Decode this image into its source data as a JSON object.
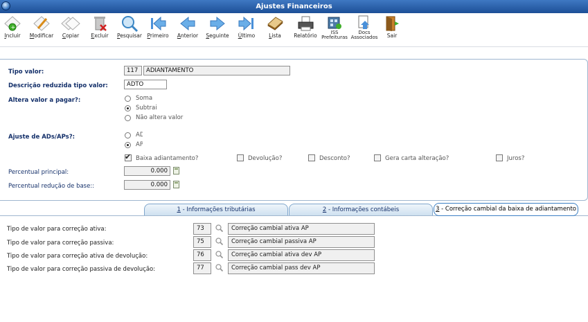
{
  "window": {
    "title": "Ajustes Financeiros"
  },
  "toolbar": {
    "items": [
      {
        "key": "I",
        "rest": "ncluir",
        "icon": "add-icon"
      },
      {
        "key": "M",
        "rest": "odificar",
        "icon": "edit-icon"
      },
      {
        "key": "C",
        "rest": "opiar",
        "icon": "copy-icon"
      },
      {
        "key": "E",
        "rest": "xcluir",
        "icon": "delete-icon"
      },
      {
        "key": "P",
        "rest": "esquisar",
        "icon": "search-icon"
      },
      {
        "key": "P",
        "rest": "rimeiro",
        "icon": "first-icon"
      },
      {
        "key": "A",
        "rest": "nterior",
        "icon": "previous-icon"
      },
      {
        "key": "S",
        "rest": "eguinte",
        "icon": "next-icon"
      },
      {
        "key": "Ú",
        "rest": "ltimo",
        "icon": "last-icon"
      },
      {
        "key": "L",
        "rest": "ista",
        "icon": "list-icon"
      },
      {
        "key": "",
        "rest": "Relatório",
        "icon": "printer-icon"
      },
      {
        "line1": "ISS",
        "line2": "Prefeituras",
        "icon": "iss-icon"
      },
      {
        "line1": "Docs",
        "line2": "Associados",
        "icon": "docs-icon"
      },
      {
        "key": "",
        "rest": "Sair",
        "icon": "exit-icon"
      }
    ]
  },
  "form": {
    "tipo_valor": {
      "label": "Tipo valor:",
      "code": "117",
      "name": "ADIANTAMENTO"
    },
    "descricao": {
      "label": "Descrição reduzida tipo valor:",
      "value": "ADTO"
    },
    "altera": {
      "label": "Altera valor a pagar?:",
      "options": [
        "Soma",
        "Subtrai",
        "Não altera valor"
      ],
      "selected": "Subtrai"
    },
    "ajuste": {
      "label": "Ajuste de ADs/APs?:",
      "options": [
        "AD",
        "AP"
      ],
      "selected": "AP"
    },
    "checks": [
      {
        "label": "Baixa adiantamento?",
        "checked": true
      },
      {
        "label": "Devolução?",
        "checked": false
      },
      {
        "label": "Desconto?",
        "checked": false
      },
      {
        "label": "Gera carta alteração?",
        "checked": false
      },
      {
        "label": "Juros?",
        "checked": false
      }
    ],
    "percentual_principal": {
      "label": "Percentual principal:",
      "value": "0.000"
    },
    "percentual_reducao": {
      "label": "Percentual redução de base::",
      "value": "0.000"
    }
  },
  "tabs": [
    {
      "num": "1",
      "label": " - Informações tributárias",
      "active": false
    },
    {
      "num": "2",
      "label": " - Informações contábeis",
      "active": false
    },
    {
      "num": "3",
      "label": " - Correção cambial da baixa de adiantamento",
      "active": true
    }
  ],
  "correcao": {
    "rows": [
      {
        "label": "Tipo de valor para correção ativa:",
        "code": "73",
        "desc": "Correção cambial ativa AP"
      },
      {
        "label": "Tipo de valor para correção passiva:",
        "code": "75",
        "desc": "Correção cambial passiva AP"
      },
      {
        "label": "Tipo de valor para correção ativa de devolução:",
        "code": "76",
        "desc": "Correção cambial ativa dev AP"
      },
      {
        "label": "Tipo de valor para correção passiva de devolução:",
        "code": "77",
        "desc": "Correção cambial pass dev AP"
      }
    ]
  },
  "colors": {
    "titlebar": "#1c4f97",
    "label_blue": "#14306a",
    "tab_border": "#3b7fc4"
  }
}
